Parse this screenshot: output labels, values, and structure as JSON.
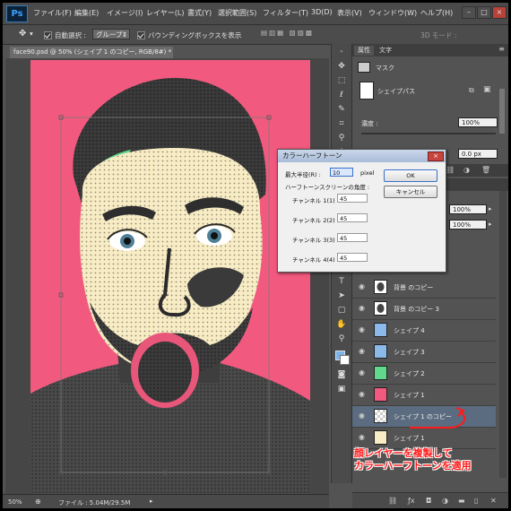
{
  "app": {
    "logo": "Ps"
  },
  "menu": [
    "ファイル(F)",
    "編集(E)",
    "イメージ(I)",
    "レイヤー(L)",
    "書式(Y)",
    "選択範囲(S)",
    "フィルター(T)",
    "3D(D)",
    "表示(V)",
    "ウィンドウ(W)",
    "ヘルプ(H)"
  ],
  "window_controls": {
    "minimize": "–",
    "maximize": "□",
    "close": "×"
  },
  "options": {
    "auto_select_label": "自動選択 :",
    "auto_select_value": "グループ",
    "bounding_box_label": "バウンディングボックスを表示",
    "mode_3d_label": "3D モード :"
  },
  "document": {
    "tab_title": "face90.psd @ 50% (シェイプ 1 のコピー, RGB/8#) *",
    "close": "×"
  },
  "status": {
    "zoom": "50%",
    "file_info": "ファイル : 5.04M/29.5M"
  },
  "properties": {
    "tab_properties": "属性",
    "tab_character": "文字",
    "mask_label": "マスク",
    "shape_path_label": "シェイプパス",
    "density_label": "濃度 :",
    "density_value": "100%",
    "feather_value": "0.0 px"
  },
  "layers_panel": {
    "opacity_value": "100%",
    "fill_value": "100%",
    "layers": [
      {
        "name": "背景 のコピー",
        "thumb": "face"
      },
      {
        "name": "背景 のコピー 3",
        "thumb": "face"
      },
      {
        "name": "シェイプ 4",
        "thumb": "blue"
      },
      {
        "name": "シェイプ 3",
        "thumb": "blue"
      },
      {
        "name": "シェイプ 2",
        "thumb": "green"
      },
      {
        "name": "シェイプ 1",
        "thumb": "pink"
      },
      {
        "name": "シェイプ 1 のコピー",
        "thumb": "checker",
        "selected": true
      },
      {
        "name": "シェイプ 1",
        "thumb": "cream"
      }
    ]
  },
  "dialog": {
    "title": "カラーハーフトーン",
    "close": "×",
    "max_radius_label": "最大半径(R) :",
    "max_radius_value": "10",
    "max_radius_unit": "pixel",
    "screen_angle_label": "ハーフトーンスクリーンの角度 :",
    "channels": [
      {
        "label": "チャンネル 1(1) :",
        "value": "45"
      },
      {
        "label": "チャンネル 2(2) :",
        "value": "45"
      },
      {
        "label": "チャンネル 3(3) :",
        "value": "45"
      },
      {
        "label": "チャンネル 4(4) :",
        "value": "45"
      }
    ],
    "ok": "OK",
    "cancel": "キャンセル"
  },
  "annotation": [
    "顔レイヤーを複製して",
    "カラーハーフトーンを適用"
  ],
  "colors": {
    "canvas_pink": "#f2597f",
    "accent_annotation": "#ff1a1a",
    "selected_layer": "#5c6c80"
  }
}
